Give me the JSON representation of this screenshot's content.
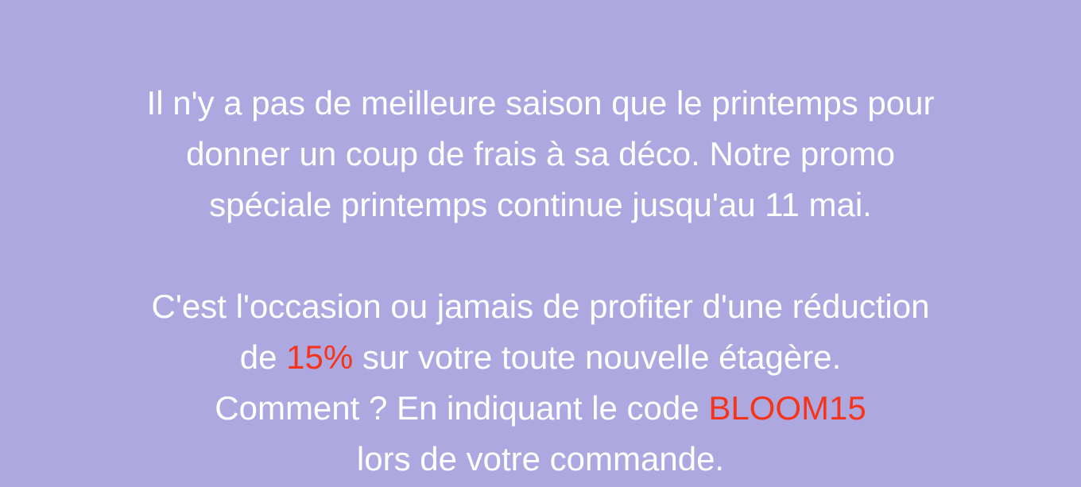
{
  "promo": {
    "paragraph1": {
      "line1": "Il n'y a pas de meilleure saison que le printemps pour",
      "line2": "donner un coup de frais à sa déco. Notre promo",
      "line3": "spéciale printemps continue jusqu'au 11 mai."
    },
    "paragraph2": {
      "line1": "C'est l'occasion ou jamais de profiter d'une réduction",
      "line2_prefix": "de ",
      "discount": "15%",
      "line2_suffix": " sur votre toute nouvelle étagère.",
      "line3_prefix": "Comment ? En indiquant le code ",
      "promo_code": "BLOOM15",
      "line4": "lors de votre commande."
    }
  },
  "colors": {
    "background": "#ADA9E0",
    "text": "#FFFFFF",
    "highlight": "#F5341B"
  }
}
